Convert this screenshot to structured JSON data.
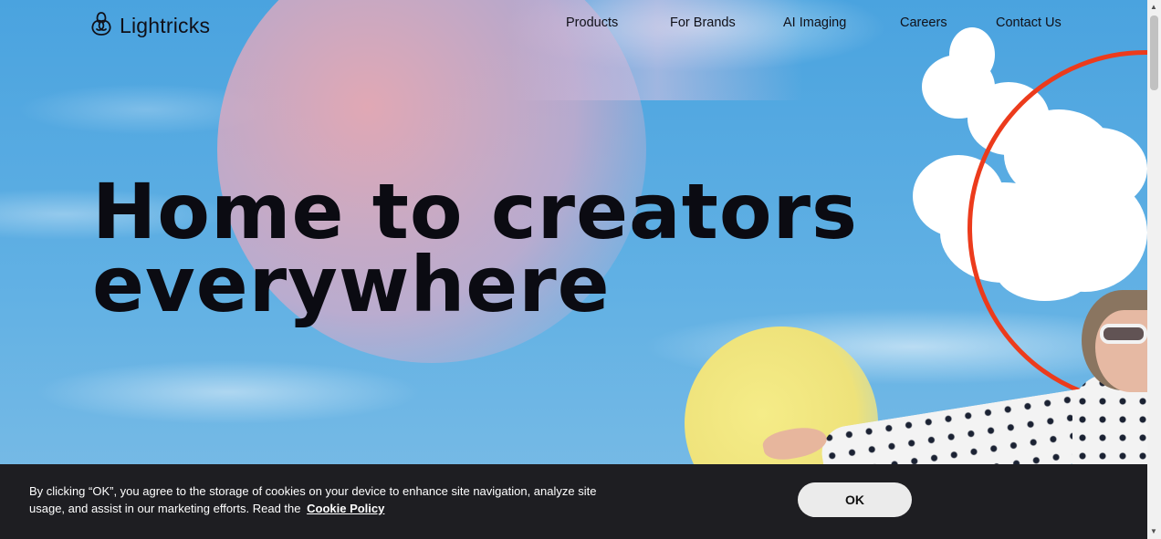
{
  "brand": {
    "name": "Lightricks",
    "logo_icon": "lightricks-knot-icon"
  },
  "nav": {
    "items": [
      {
        "label": "Products"
      },
      {
        "label": "For Brands"
      },
      {
        "label": "AI Imaging"
      },
      {
        "label": "Careers"
      },
      {
        "label": "Contact Us"
      }
    ]
  },
  "hero": {
    "headline_line1": "Home to creators",
    "headline_line2": "everywhere"
  },
  "cookie": {
    "text": "By clicking “OK”, you agree to the storage of cookies on your device to enhance site navigation, analyze site usage, and assist in our marketing efforts. Read the",
    "link_label": "Cookie Policy",
    "ok_label": "OK"
  },
  "colors": {
    "sky": "#5aa8dc",
    "ring": "#ec3b1c",
    "cookie_bar": "#1e1e22",
    "text_dark": "#0b0b12"
  }
}
